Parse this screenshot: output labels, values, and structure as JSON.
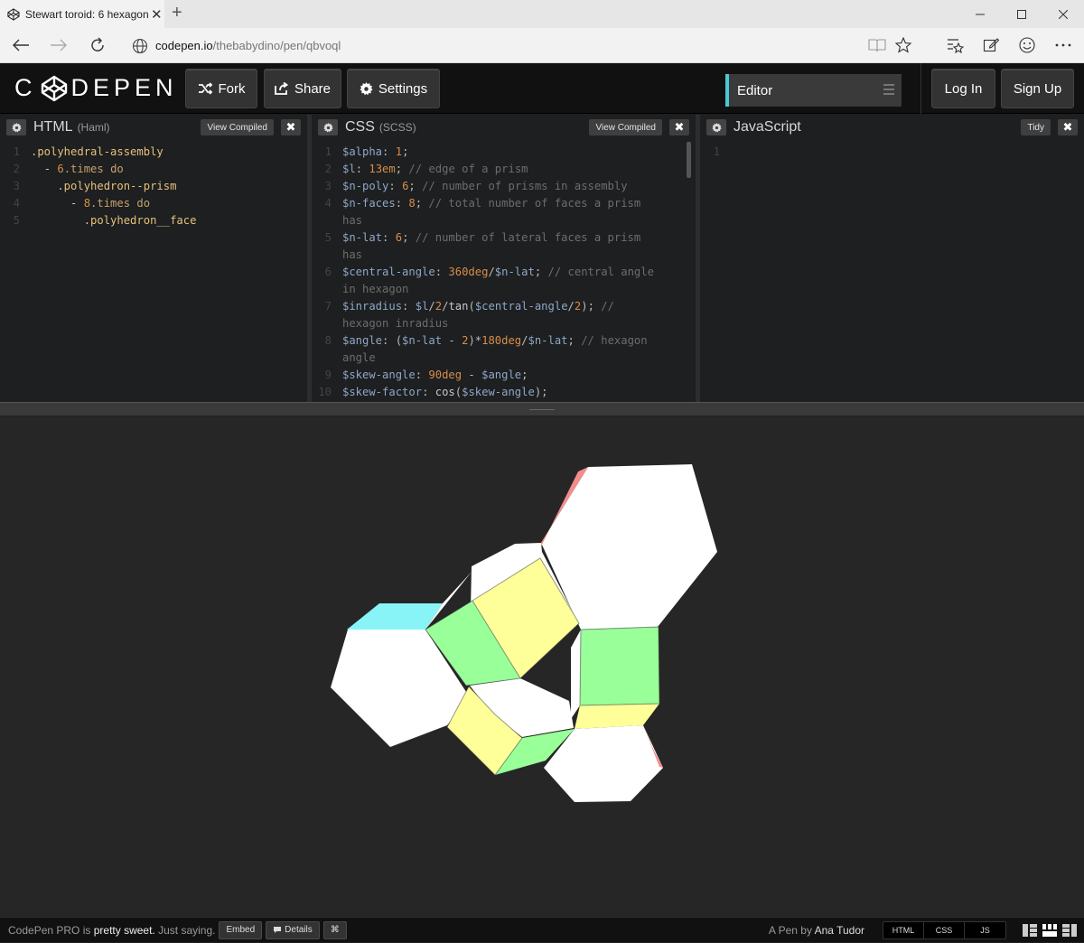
{
  "browser": {
    "tab_title": "Stewart toroid: 6 hexagon",
    "tab_close": "✕",
    "new_tab": "+",
    "url_host": "codepen.io",
    "url_path": "/thebabydino/pen/qbvoql"
  },
  "header": {
    "logo_text_left": "C",
    "logo_text_right": "DEPEN",
    "fork_label": "Fork",
    "share_label": "Share",
    "settings_label": "Settings",
    "editor_view_label": "Editor",
    "login_label": "Log In",
    "signup_label": "Sign Up"
  },
  "panes": {
    "html": {
      "title": "HTML",
      "sub": "(Haml)",
      "view_compiled": "View Compiled",
      "lines": [
        {
          "n": "1",
          "tokens": [
            {
              "c": "c-sel",
              "t": ".polyhedral-assembly"
            }
          ]
        },
        {
          "n": "2",
          "tokens": [
            {
              "c": "c-txt",
              "t": "  - "
            },
            {
              "c": "c-num",
              "t": "6"
            },
            {
              "c": "c-kw",
              "t": ".times do"
            }
          ]
        },
        {
          "n": "3",
          "tokens": [
            {
              "c": "c-sel",
              "t": "    .polyhedron--prism"
            }
          ]
        },
        {
          "n": "4",
          "tokens": [
            {
              "c": "c-txt",
              "t": "      - "
            },
            {
              "c": "c-num",
              "t": "8"
            },
            {
              "c": "c-kw",
              "t": ".times do"
            }
          ]
        },
        {
          "n": "5",
          "tokens": [
            {
              "c": "c-sel",
              "t": "        .polyhedron__face"
            }
          ]
        }
      ]
    },
    "css": {
      "title": "CSS",
      "sub": "(SCSS)",
      "view_compiled": "View Compiled",
      "lines": [
        {
          "n": "1",
          "tokens": [
            {
              "c": "c-var",
              "t": "$alpha"
            },
            {
              "c": "c-op",
              "t": ": "
            },
            {
              "c": "c-num",
              "t": "1"
            },
            {
              "c": "c-op",
              "t": ";"
            }
          ]
        },
        {
          "n": "2",
          "tokens": [
            {
              "c": "c-var",
              "t": "$l"
            },
            {
              "c": "c-op",
              "t": ": "
            },
            {
              "c": "c-num",
              "t": "13em"
            },
            {
              "c": "c-op",
              "t": "; "
            },
            {
              "c": "c-cm",
              "t": "// edge of a prism"
            }
          ]
        },
        {
          "n": "3",
          "tokens": [
            {
              "c": "c-var",
              "t": "$n-poly"
            },
            {
              "c": "c-op",
              "t": ": "
            },
            {
              "c": "c-num",
              "t": "6"
            },
            {
              "c": "c-op",
              "t": "; "
            },
            {
              "c": "c-cm",
              "t": "// number of prisms in assembly"
            }
          ]
        },
        {
          "n": "4",
          "tokens": [
            {
              "c": "c-var",
              "t": "$n-faces"
            },
            {
              "c": "c-op",
              "t": ": "
            },
            {
              "c": "c-num",
              "t": "8"
            },
            {
              "c": "c-op",
              "t": "; "
            },
            {
              "c": "c-cm",
              "t": "// total number of faces a prism"
            }
          ]
        },
        {
          "n": "",
          "tokens": [
            {
              "c": "c-cm",
              "t": "has"
            }
          ]
        },
        {
          "n": "5",
          "tokens": [
            {
              "c": "c-var",
              "t": "$n-lat"
            },
            {
              "c": "c-op",
              "t": ": "
            },
            {
              "c": "c-num",
              "t": "6"
            },
            {
              "c": "c-op",
              "t": "; "
            },
            {
              "c": "c-cm",
              "t": "// number of lateral faces a prism"
            }
          ]
        },
        {
          "n": "",
          "tokens": [
            {
              "c": "c-cm",
              "t": "has"
            }
          ]
        },
        {
          "n": "6",
          "tokens": [
            {
              "c": "c-var",
              "t": "$central-angle"
            },
            {
              "c": "c-op",
              "t": ": "
            },
            {
              "c": "c-num",
              "t": "360deg"
            },
            {
              "c": "c-op",
              "t": "/"
            },
            {
              "c": "c-var",
              "t": "$n-lat"
            },
            {
              "c": "c-op",
              "t": "; "
            },
            {
              "c": "c-cm",
              "t": "// central angle"
            }
          ]
        },
        {
          "n": "",
          "tokens": [
            {
              "c": "c-cm",
              "t": "in hexagon"
            }
          ]
        },
        {
          "n": "7",
          "tokens": [
            {
              "c": "c-var",
              "t": "$inradius"
            },
            {
              "c": "c-op",
              "t": ": "
            },
            {
              "c": "c-var",
              "t": "$l"
            },
            {
              "c": "c-op",
              "t": "/"
            },
            {
              "c": "c-num",
              "t": "2"
            },
            {
              "c": "c-op",
              "t": "/"
            },
            {
              "c": "c-fn",
              "t": "tan"
            },
            {
              "c": "c-op",
              "t": "("
            },
            {
              "c": "c-var",
              "t": "$central-angle"
            },
            {
              "c": "c-op",
              "t": "/"
            },
            {
              "c": "c-num",
              "t": "2"
            },
            {
              "c": "c-op",
              "t": "); "
            },
            {
              "c": "c-cm",
              "t": "//"
            }
          ]
        },
        {
          "n": "",
          "tokens": [
            {
              "c": "c-cm",
              "t": "hexagon inradius"
            }
          ]
        },
        {
          "n": "8",
          "tokens": [
            {
              "c": "c-var",
              "t": "$angle"
            },
            {
              "c": "c-op",
              "t": ": ("
            },
            {
              "c": "c-var",
              "t": "$n-lat"
            },
            {
              "c": "c-op",
              "t": " - "
            },
            {
              "c": "c-num",
              "t": "2"
            },
            {
              "c": "c-op",
              "t": ")*"
            },
            {
              "c": "c-num",
              "t": "180deg"
            },
            {
              "c": "c-op",
              "t": "/"
            },
            {
              "c": "c-var",
              "t": "$n-lat"
            },
            {
              "c": "c-op",
              "t": "; "
            },
            {
              "c": "c-cm",
              "t": "// hexagon"
            }
          ]
        },
        {
          "n": "",
          "tokens": [
            {
              "c": "c-cm",
              "t": "angle"
            }
          ]
        },
        {
          "n": "9",
          "tokens": [
            {
              "c": "c-var",
              "t": "$skew-angle"
            },
            {
              "c": "c-op",
              "t": ": "
            },
            {
              "c": "c-num",
              "t": "90deg"
            },
            {
              "c": "c-op",
              "t": " - "
            },
            {
              "c": "c-var",
              "t": "$angle"
            },
            {
              "c": "c-op",
              "t": ";"
            }
          ]
        },
        {
          "n": "10",
          "tokens": [
            {
              "c": "c-var",
              "t": "$skew-factor"
            },
            {
              "c": "c-op",
              "t": ": "
            },
            {
              "c": "c-fn",
              "t": "cos"
            },
            {
              "c": "c-op",
              "t": "("
            },
            {
              "c": "c-var",
              "t": "$skew-angle"
            },
            {
              "c": "c-op",
              "t": ");"
            }
          ]
        }
      ]
    },
    "js": {
      "title": "JavaScript",
      "tidy": "Tidy",
      "lines": [
        {
          "n": "1",
          "tokens": []
        }
      ]
    }
  },
  "footer": {
    "pro_prefix": "CodePen PRO",
    "pro_mid": " is ",
    "pro_bold": "pretty sweet.",
    "pro_suffix": " Just saying.",
    "embed_label": "Embed",
    "details_label": "Details",
    "cmd_label": "⌘",
    "pen_by": "A Pen by ",
    "author": "Ana Tudor",
    "lang_html": "HTML",
    "lang_css": "CSS",
    "lang_js": "JS"
  },
  "colors": {
    "accent": "#4ac8d8",
    "face_white": "#ffffff",
    "face_yellow": "#ffff99",
    "face_green": "#99ff99",
    "face_cyan": "#88f4f8",
    "face_red": "#f58b8b"
  }
}
